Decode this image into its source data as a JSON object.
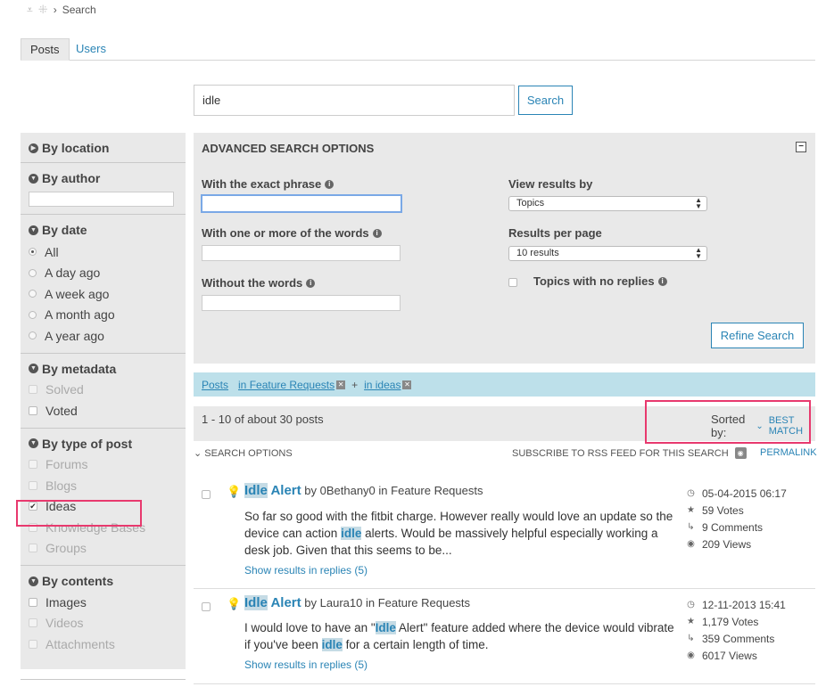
{
  "breadcrumb": {
    "current": "Search"
  },
  "tabs": [
    {
      "label": "Posts"
    },
    {
      "label": "Users"
    }
  ],
  "search": {
    "value": "idle",
    "button": "Search"
  },
  "sidebar": {
    "location": {
      "title": "By location"
    },
    "author": {
      "title": "By author"
    },
    "date": {
      "title": "By date",
      "options": [
        "All",
        "A day ago",
        "A week ago",
        "A month ago",
        "A year ago"
      ],
      "selected": "All"
    },
    "metadata": {
      "title": "By metadata",
      "options": [
        "Solved",
        "Voted"
      ]
    },
    "type": {
      "title": "By type of post",
      "options": [
        "Forums",
        "Blogs",
        "Ideas",
        "Knowledge Bases",
        "Groups"
      ],
      "checked": "Ideas"
    },
    "contents": {
      "title": "By contents",
      "options": [
        "Images",
        "Videos",
        "Attachments"
      ]
    }
  },
  "advanced": {
    "title": "ADVANCED SEARCH OPTIONS",
    "exact_phrase": "With the exact phrase",
    "one_or_more": "With one or more of the words",
    "without": "Without the words",
    "view_by": "View results by",
    "view_by_value": "Topics",
    "per_page": "Results per page",
    "per_page_value": "10 results",
    "no_replies": "Topics with no replies",
    "refine": "Refine Search"
  },
  "filters": {
    "posts": "Posts",
    "feature": "in Feature Requests",
    "plus": "+",
    "ideas": "in ideas"
  },
  "results_bar": {
    "count": "1 - 10 of about 30 posts",
    "sorted_by": "Sorted by:",
    "sort_value": "BEST MATCH"
  },
  "options_row": {
    "search_options": "SEARCH OPTIONS",
    "rss": "SUBSCRIBE TO RSS FEED FOR THIS SEARCH",
    "permalink": "PERMALINK"
  },
  "results": [
    {
      "title_hl": "Idle",
      "title_rest": " Alert",
      "by": "by",
      "author": "0Bethany0",
      "in": "in Feature Requests",
      "body_1": "So far so good with the fitbit charge. However really would love an update so the device can action ",
      "body_hl": "idle",
      "body_2": " alerts. Would be massively helpful especially working a desk job. Given that this seems to be...",
      "link": "Show results in replies (5)",
      "date": "05-04-2015 06:17",
      "votes": "59 Votes",
      "comments": "9 Comments",
      "views": "209 Views"
    },
    {
      "title_hl": "Idle",
      "title_rest": " Alert",
      "by": "by",
      "author": "Laura10",
      "in": "in Feature Requests",
      "body_1": "I would love to have an \"",
      "body_hl": "Idle",
      "body_2": " Alert\" feature added where the device would vibrate if you've been ",
      "body_hl2": "idle",
      "body_3": " for a certain length of time.",
      "link": "Show results in replies (5)",
      "date": "12-11-2013 15:41",
      "votes": "1,179 Votes",
      "comments": "359 Comments",
      "views": "6017 Views"
    }
  ]
}
